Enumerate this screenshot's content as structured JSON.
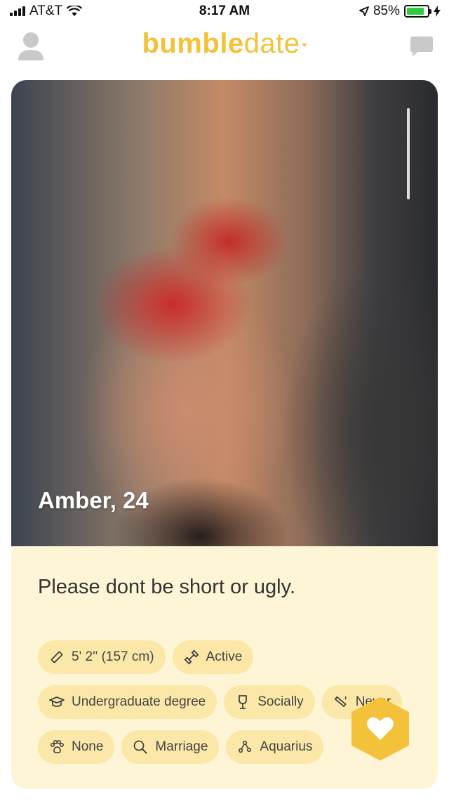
{
  "status_bar": {
    "carrier": "AT&T",
    "time": "8:17 AM",
    "battery": "85%",
    "battery_level": 0.85
  },
  "header": {
    "logo_bold": "bumble",
    "logo_light": "date",
    "profile_icon": "profile-icon",
    "chat_icon": "chat-icon",
    "brand_color": "#f3c23a"
  },
  "profile": {
    "name_age": "Amber, 24",
    "bio": "Please dont be short or ugly."
  },
  "chips": {
    "row1": [
      {
        "icon": "ruler-icon",
        "label": "5' 2'' (157 cm)"
      },
      {
        "icon": "dumbbell-icon",
        "label": "Active"
      }
    ],
    "row2": [
      {
        "icon": "graduation-cap-icon",
        "label": "Undergraduate degree"
      },
      {
        "icon": "wine-glass-icon",
        "label": "Socially"
      },
      {
        "icon": "cigarette-icon",
        "label": "Never"
      }
    ],
    "row3": [
      {
        "icon": "paw-icon",
        "label": "None"
      },
      {
        "icon": "search-icon",
        "label": "Marriage"
      },
      {
        "icon": "zodiac-icon",
        "label": "Aquarius"
      }
    ]
  },
  "like_button": {
    "icon": "heart-icon",
    "color": "#f3c23a"
  }
}
